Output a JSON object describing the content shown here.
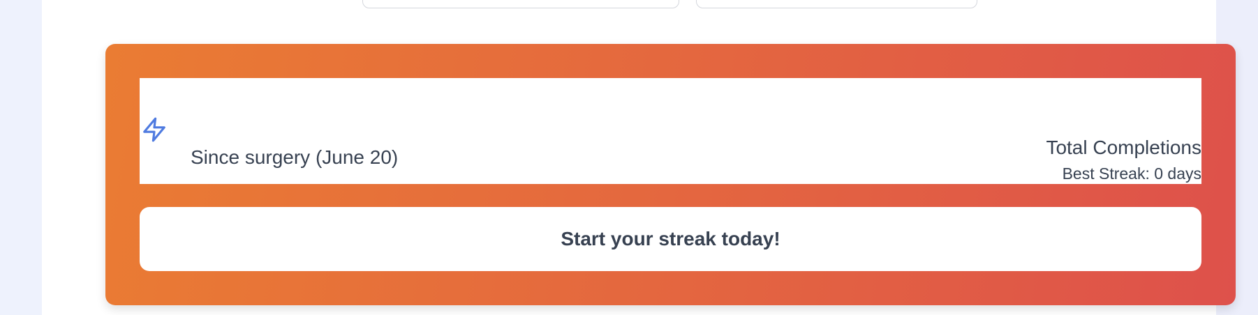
{
  "streak_card": {
    "subtitle": "Since surgery (June 20)",
    "total_label": "Total Completions",
    "best_streak": "Best Streak: 0 days",
    "cta": "Start your streak today!",
    "icon": "lightning-bolt-icon"
  },
  "colors": {
    "gradient_start": "#ea7c33",
    "gradient_end": "#de514b",
    "icon": "#4f7be0",
    "text": "#374151"
  }
}
